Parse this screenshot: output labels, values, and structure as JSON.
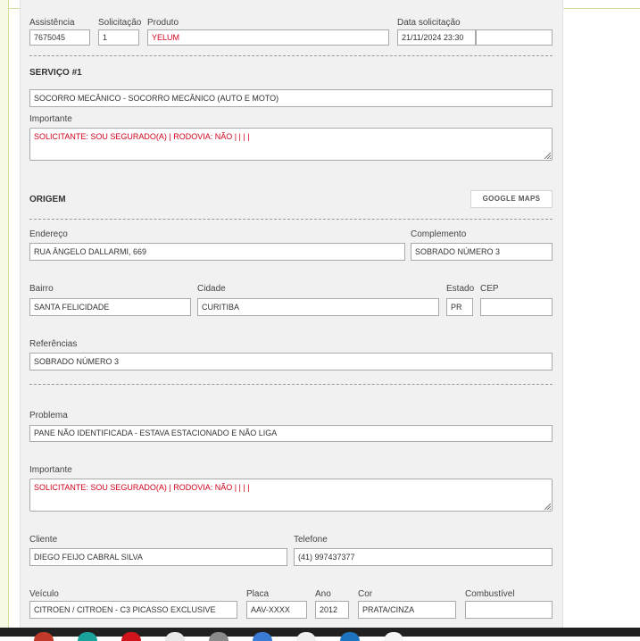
{
  "form": {
    "assistencia": {
      "label": "Assistência",
      "value": "7675045"
    },
    "solicitacao": {
      "label": "Solicitação",
      "value": "1"
    },
    "produto": {
      "label": "Produto",
      "value": "YELUM"
    },
    "data_solicitacao": {
      "label": "Data solicitação",
      "value": "21/11/2024 23:30",
      "extra": ""
    },
    "servico": {
      "title": "SERVIÇO #1",
      "value": "SOCORRO MECÂNICO - SOCORRO MECÂNICO (AUTO E MOTO)",
      "importante_label": "Importante",
      "importante": "SOLICITANTE: SOU SEGURADO(A) | RODOVIA: NÃO |  |  |  |"
    },
    "origem": {
      "title": "ORIGEM",
      "google_maps": "GOOGLE MAPS",
      "endereco": {
        "label": "Endereço",
        "value": "RUA ÂNGELO DALLARMI, 669"
      },
      "complemento": {
        "label": "Complemento",
        "value": "SOBRADO NÚMERO 3"
      },
      "bairro": {
        "label": "Bairro",
        "value": "SANTA FELICIDADE"
      },
      "cidade": {
        "label": "Cidade",
        "value": "CURITIBA"
      },
      "estado": {
        "label": "Estado",
        "value": "PR"
      },
      "cep": {
        "label": "CEP",
        "value": ""
      },
      "referencias": {
        "label": "Referências",
        "value": "SOBRADO NÚMERO 3"
      }
    },
    "problema": {
      "label": "Problema",
      "value": "PANE NÃO IDENTIFICADA - ESTAVA ESTACIONADO E NÃO LIGA"
    },
    "importante2": {
      "label": "Importante",
      "value": "SOLICITANTE: SOU SEGURADO(A) | RODOVIA: NÃO |  |  |  |"
    },
    "cliente": {
      "label": "Cliente",
      "value": "DIEGO FEIJO CABRAL SILVA"
    },
    "telefone": {
      "label": "Telefone",
      "value": "(41) 997437377"
    },
    "veiculo": {
      "label": "Veículo",
      "value": "CITROEN / CITROEN - C3 PICASSO EXCLUSIVE"
    },
    "placa": {
      "label": "Placa",
      "value": "AAV-XXXX"
    },
    "ano": {
      "label": "Ano",
      "value": "2012"
    },
    "cor": {
      "label": "Cor",
      "value": "PRATA/CINZA"
    },
    "combustivel": {
      "label": "Combustível",
      "value": ""
    }
  },
  "taskbar": {
    "icons": [
      "red-app-icon",
      "teal-app-icon",
      "red-app-icon-2",
      "white-app-icon",
      "gray-app-icon",
      "blue-app-icon",
      "white-app-icon-2",
      "blue-app-icon-2",
      "white-app-icon-3"
    ],
    "colors": [
      "#c0392b",
      "#1aa39a",
      "#d0141c",
      "#e8e8e8",
      "#8a8a8a",
      "#3a7bd5",
      "#f0f0f0",
      "#1e73be",
      "#f5f5f5"
    ]
  }
}
